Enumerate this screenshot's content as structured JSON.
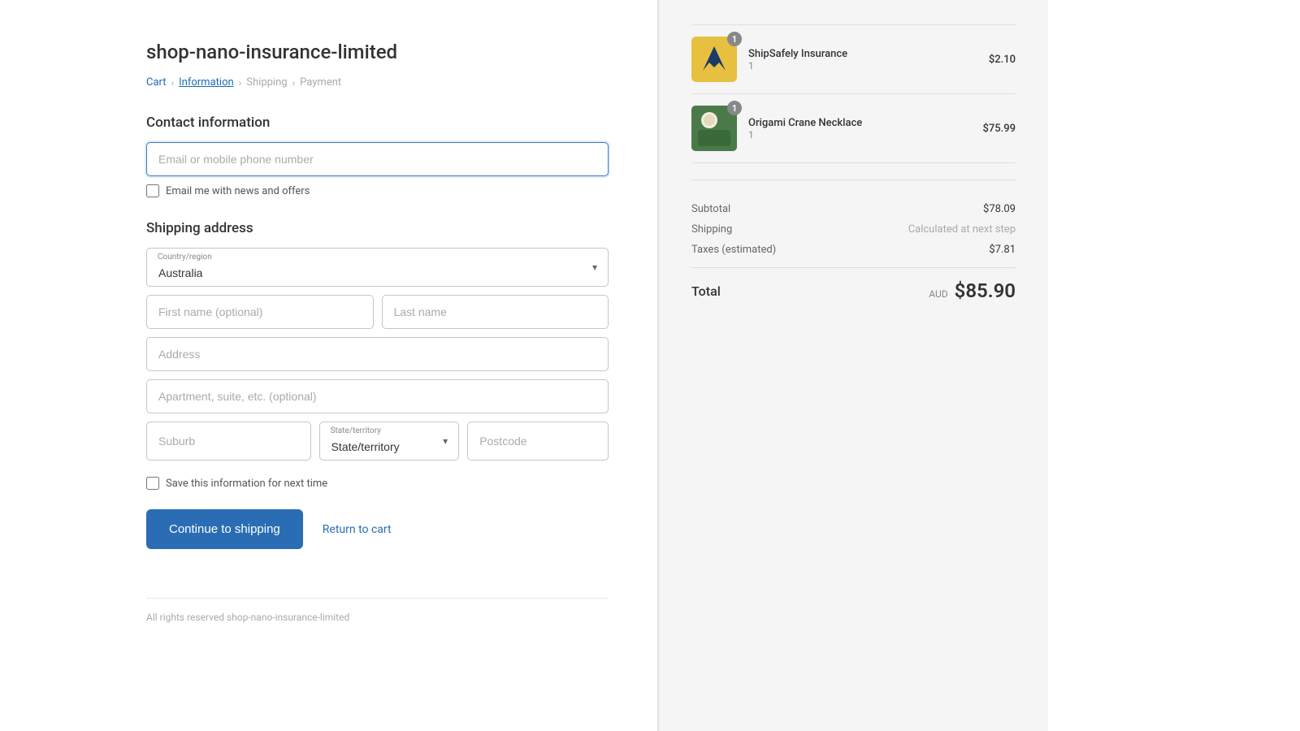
{
  "store": {
    "title": "shop-nano-insurance-limited",
    "footer": "All rights reserved shop-nano-insurance-limited"
  },
  "breadcrumb": {
    "cart": "Cart",
    "information": "Information",
    "shipping": "Shipping",
    "payment": "Payment"
  },
  "contact": {
    "section_title": "Contact information",
    "email_placeholder": "Email or mobile phone number",
    "newsletter_label": "Email me with news and offers"
  },
  "shipping": {
    "section_title": "Shipping address",
    "country_label": "Country/region",
    "country_value": "Australia",
    "first_name_placeholder": "First name (optional)",
    "last_name_placeholder": "Last name",
    "address_placeholder": "Address",
    "apartment_placeholder": "Apartment, suite, etc. (optional)",
    "suburb_placeholder": "Suburb",
    "state_label": "State/territory",
    "state_placeholder": "State/territory",
    "postcode_placeholder": "Postcode",
    "save_label": "Save this information for next time"
  },
  "actions": {
    "continue_button": "Continue to shipping",
    "return_link": "Return to cart"
  },
  "order": {
    "items": [
      {
        "id": "shipsafely",
        "name": "ShipSafely Insurance",
        "qty": "1",
        "price": "$2.10",
        "badge": "1"
      },
      {
        "id": "origami",
        "name": "Origami Crane Necklace",
        "qty": "1",
        "price": "$75.99",
        "badge": "1"
      }
    ],
    "subtotal_label": "Subtotal",
    "subtotal_value": "$78.09",
    "shipping_label": "Shipping",
    "shipping_value": "Calculated at next step",
    "taxes_label": "Taxes (estimated)",
    "taxes_value": "$7.81",
    "total_label": "Total",
    "total_currency": "AUD",
    "total_amount": "$85.90"
  }
}
